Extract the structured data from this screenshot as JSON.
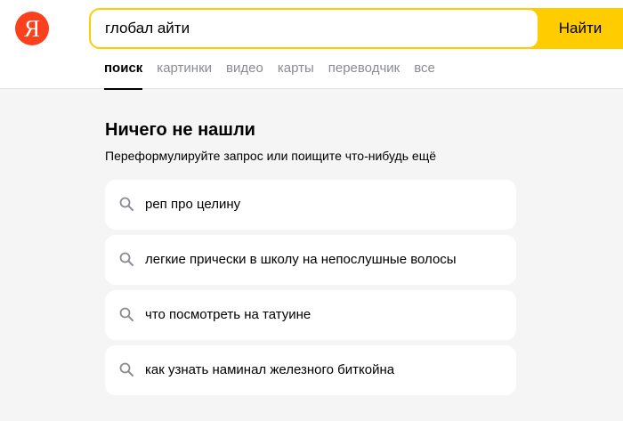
{
  "header": {
    "logo_text": "Я",
    "search": {
      "value": "глобал айти",
      "button_label": "Найти"
    },
    "tabs": [
      {
        "label": "поиск",
        "active": true
      },
      {
        "label": "картинки",
        "active": false
      },
      {
        "label": "видео",
        "active": false
      },
      {
        "label": "карты",
        "active": false
      },
      {
        "label": "переводчик",
        "active": false
      },
      {
        "label": "все",
        "active": false
      }
    ]
  },
  "main": {
    "title": "Ничего не нашли",
    "subtitle": "Переформулируйте запрос или поищите что-нибудь ещё",
    "suggestions": [
      {
        "icon": "search-icon",
        "label": "реп про целину"
      },
      {
        "icon": "search-icon",
        "label": "легкие прически в школу на непослушные волосы"
      },
      {
        "icon": "search-icon",
        "label": "что посмотреть на татуине"
      },
      {
        "icon": "search-icon",
        "label": "как узнать наминал железного биткойна"
      }
    ]
  },
  "colors": {
    "brand_logo": "#fc3f1d",
    "accent_yellow": "#ffcc00",
    "background": "#f5f5f6",
    "tab_inactive": "#8a8c93"
  }
}
